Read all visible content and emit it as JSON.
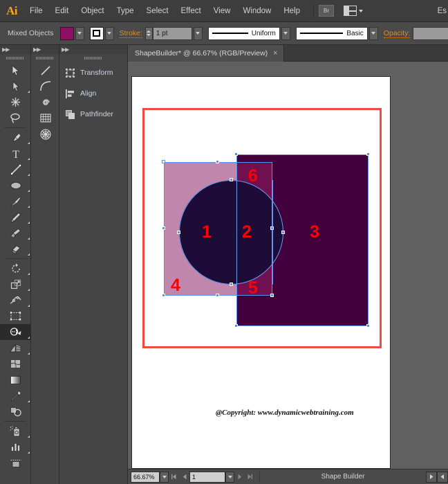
{
  "app": {
    "logo": "Ai",
    "workspace_label": "Es"
  },
  "menubar": {
    "items": [
      {
        "label": "File"
      },
      {
        "label": "Edit"
      },
      {
        "label": "Object"
      },
      {
        "label": "Type"
      },
      {
        "label": "Select"
      },
      {
        "label": "Effect"
      },
      {
        "label": "View"
      },
      {
        "label": "Window"
      },
      {
        "label": "Help"
      }
    ],
    "bridge_label": "Br"
  },
  "controlbar": {
    "selection_label": "Mixed Objects",
    "fill_color": "#8e1063",
    "stroke_label": "Stroke:",
    "stroke_weight": "1 pt",
    "profile_label": "Uniform",
    "brush_label": "Basic",
    "opacity_label": "Opacity:",
    "opacity_value": ""
  },
  "toolbar": {
    "tools_col1": [
      {
        "name": "selection-tool"
      },
      {
        "name": "direct-selection-tool"
      },
      {
        "name": "magic-wand-tool"
      },
      {
        "name": "lasso-tool"
      },
      {
        "name": "pen-tool"
      },
      {
        "name": "type-tool"
      },
      {
        "name": "line-segment-tool"
      },
      {
        "name": "ellipse-tool"
      },
      {
        "name": "paintbrush-tool"
      },
      {
        "name": "pencil-tool"
      },
      {
        "name": "blob-brush-tool"
      },
      {
        "name": "eraser-tool"
      },
      {
        "name": "rotate-tool"
      },
      {
        "name": "scale-tool"
      },
      {
        "name": "width-tool"
      },
      {
        "name": "free-transform-tool"
      },
      {
        "name": "shape-builder-tool"
      },
      {
        "name": "perspective-grid-tool"
      },
      {
        "name": "mesh-tool"
      },
      {
        "name": "gradient-tool"
      },
      {
        "name": "eyedropper-tool"
      },
      {
        "name": "blend-tool"
      },
      {
        "name": "symbol-sprayer-tool"
      },
      {
        "name": "column-graph-tool"
      },
      {
        "name": "artboard-tool"
      }
    ],
    "tools_col2": [
      {
        "name": "line-tool"
      },
      {
        "name": "arc-tool"
      },
      {
        "name": "spiral-tool"
      },
      {
        "name": "rectangular-grid-tool"
      },
      {
        "name": "polar-grid-tool"
      }
    ],
    "selected_tool": "shape-builder-tool"
  },
  "panels": {
    "items": [
      {
        "label": "Transform",
        "icon": "transform-icon"
      },
      {
        "label": "Align",
        "icon": "align-icon"
      },
      {
        "label": "Pathfinder",
        "icon": "pathfinder-icon"
      }
    ]
  },
  "document": {
    "tab_title": "ShapeBuilder* @ 66.67% (RGB/Preview)",
    "close_label": "×"
  },
  "artwork": {
    "artboard_border_color": "#ef4b42",
    "shapes": [
      {
        "name": "pink-rectangle",
        "color": "#c086ac"
      },
      {
        "name": "dark-purple-rectangle",
        "color": "#42003c"
      },
      {
        "name": "dark-navy-circle",
        "color": "#1d0b38"
      },
      {
        "name": "overlap-rect-region",
        "color": "#701050"
      },
      {
        "name": "circle-over-dark",
        "color": "#1d0b38"
      }
    ],
    "region_labels": [
      {
        "id": "1",
        "text": "1"
      },
      {
        "id": "2",
        "text": "2"
      },
      {
        "id": "3",
        "text": "3"
      },
      {
        "id": "4",
        "text": "4"
      },
      {
        "id": "5",
        "text": "5"
      },
      {
        "id": "6",
        "text": "6"
      }
    ],
    "copyright": "@Copyright: www.dynamicwebtraining.com",
    "selection_color": "#5b8ff0"
  },
  "statusbar": {
    "zoom_level": "66.67%",
    "page_number": "1",
    "current_tool": "Shape Builder"
  }
}
